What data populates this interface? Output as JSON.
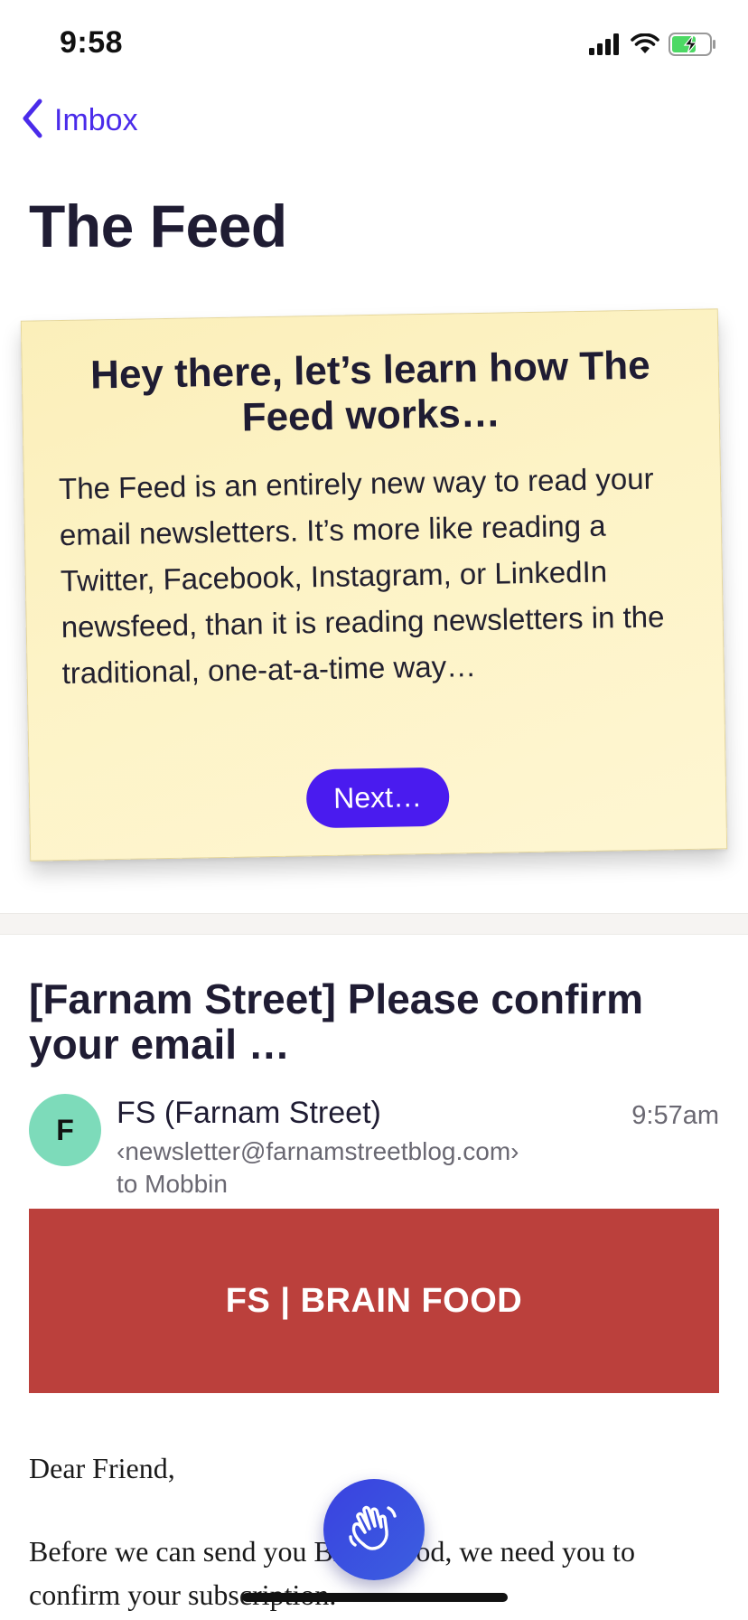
{
  "status_bar": {
    "time": "9:58",
    "signal_icon": "cellular-signal-icon",
    "wifi_icon": "wifi-icon",
    "battery_icon": "battery-charging-icon"
  },
  "nav": {
    "back_label": "Imbox",
    "back_icon": "chevron-left-icon"
  },
  "page": {
    "title": "The Feed"
  },
  "intro_card": {
    "title": "Hey there, let’s learn how The Feed works…",
    "body": "The Feed is an entirely new way to read your email newsletters. It’s more like reading a Twitter, Facebook, Instagram, or LinkedIn newsfeed, than it is reading newsletters in the traditional, one-at-a-time way…",
    "button_label": "Next…",
    "background_color": "#fcf1c0",
    "button_color": "#4a1bef"
  },
  "email": {
    "subject": "[Farnam Street] Please confirm your email …",
    "sender": {
      "avatar_letter": "F",
      "name": "FS (Farnam Street)",
      "address": "‹newsletter@farnamstreetblog.com›",
      "recipient": "to Mobbin",
      "time": "9:57am"
    },
    "banner": {
      "text": "FS | BRAIN FOOD",
      "color": "#bb403c"
    },
    "body": {
      "greeting": "Dear Friend,",
      "paragraph": "Before we can send you Brain Food, we need you to confirm your subscription."
    }
  },
  "fab": {
    "icon": "waving-hand-icon",
    "color": "#3b4ae0"
  },
  "accent_color": "#4a2bea"
}
